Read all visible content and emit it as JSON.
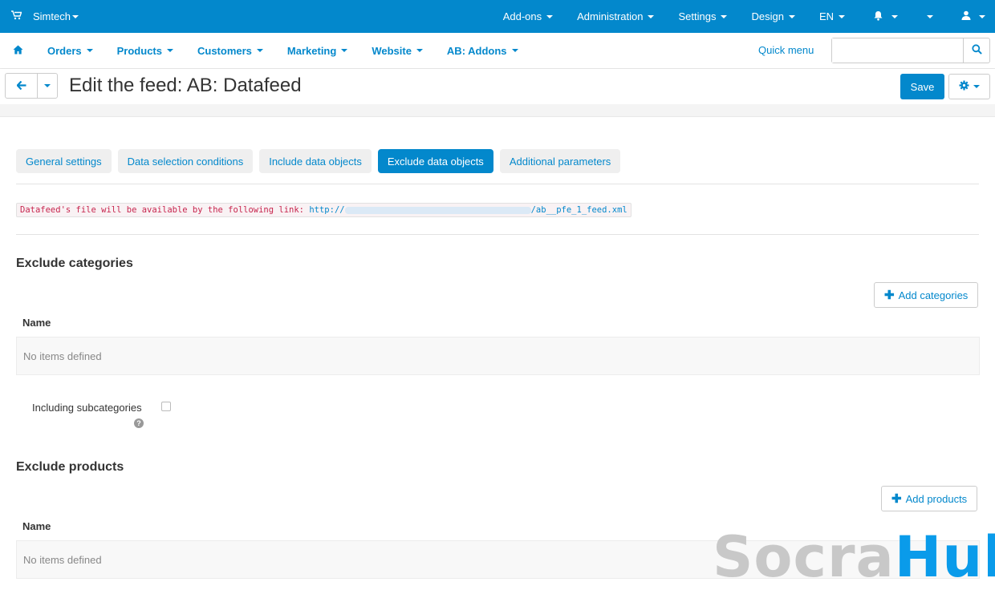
{
  "topbar": {
    "brand": "Simtech",
    "menus": [
      "Add-ons",
      "Administration",
      "Settings",
      "Design",
      "EN"
    ]
  },
  "nav": {
    "items": [
      "Orders",
      "Products",
      "Customers",
      "Marketing",
      "Website",
      "AB: Addons"
    ],
    "quick_menu": "Quick menu",
    "search_placeholder": ""
  },
  "header": {
    "title": "Edit the feed: AB: Datafeed",
    "save_label": "Save"
  },
  "tabs": [
    "General settings",
    "Data selection conditions",
    "Include data objects",
    "Exclude data objects",
    "Additional parameters"
  ],
  "active_tab": "Exclude data objects",
  "feed_link": {
    "prefix": "Datafeed's file will be available by the following link:",
    "url_start": "http://",
    "url_end": "/ab__pfe_1_feed.xml"
  },
  "exclude_categories": {
    "heading": "Exclude categories",
    "add_label": "Add categories",
    "column": "Name",
    "empty": "No items defined",
    "subcategories_label": "Including subcategories"
  },
  "exclude_products": {
    "heading": "Exclude products",
    "add_label": "Add products",
    "column": "Name",
    "empty": "No items defined"
  },
  "watermark": {
    "part1": "Socra",
    "part2": "Hub"
  },
  "colors": {
    "primary": "#0388cc",
    "danger_text": "#c7254e"
  }
}
